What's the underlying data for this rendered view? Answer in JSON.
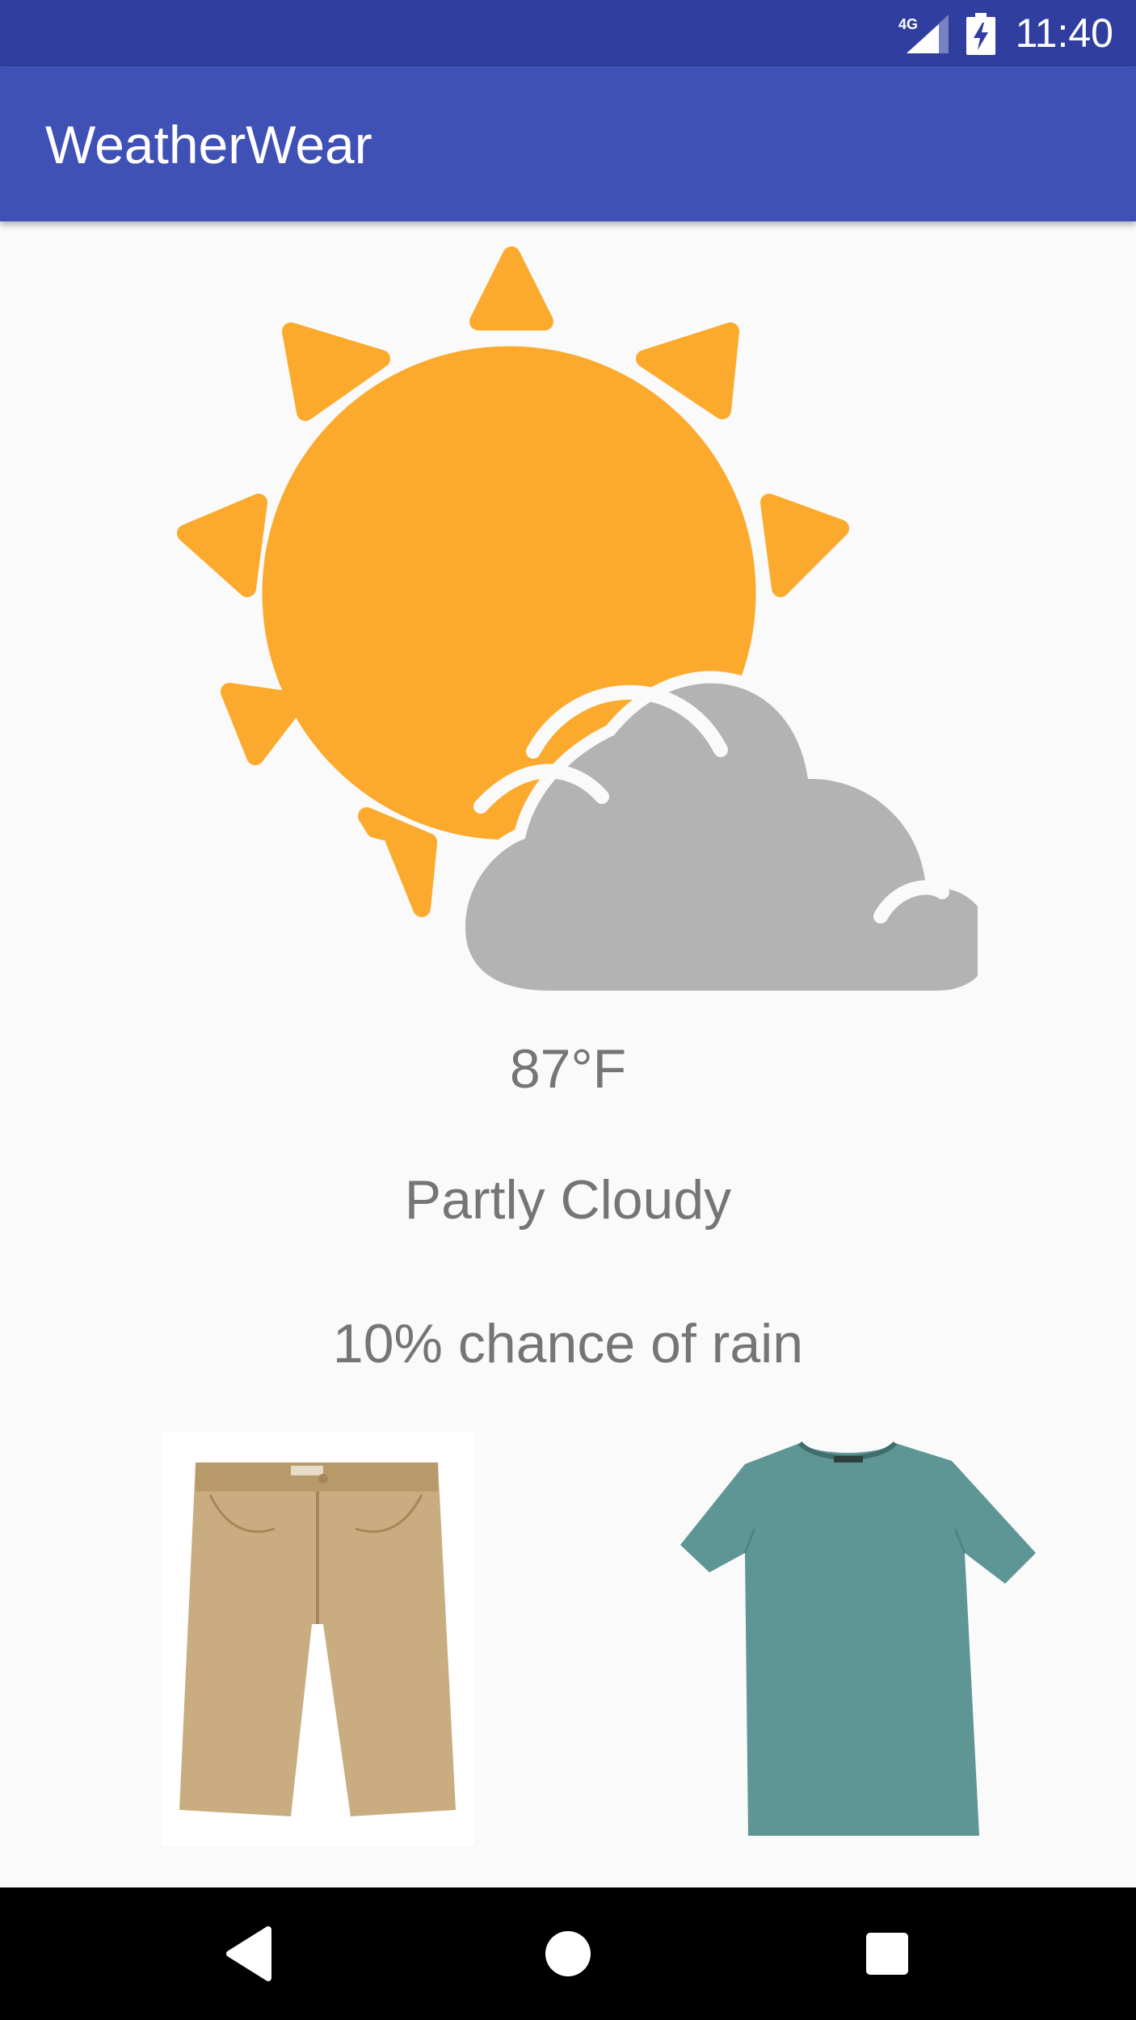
{
  "status_bar": {
    "time": "11:40",
    "network": "4G",
    "icons": [
      "signal-icon",
      "battery-icon"
    ]
  },
  "app_bar": {
    "title": "WeatherWear"
  },
  "weather": {
    "icon": "partly-cloudy-icon",
    "temperature": "87°F",
    "condition": "Partly Cloudy",
    "rain_chance": "10% chance of rain"
  },
  "clothing": {
    "items": [
      {
        "icon": "khaki-shorts-image"
      },
      {
        "icon": "teal-tshirt-image"
      }
    ]
  },
  "nav_bar": {
    "icons": [
      "back-icon",
      "home-icon",
      "recents-icon"
    ]
  },
  "colors": {
    "status_bar": "#303f9f",
    "app_bar": "#3f51b5",
    "sun": "#fbaa2d",
    "cloud": "#b3b3b3",
    "text": "#757575",
    "shorts": "#c9ac80",
    "shirt": "#5e9695"
  }
}
